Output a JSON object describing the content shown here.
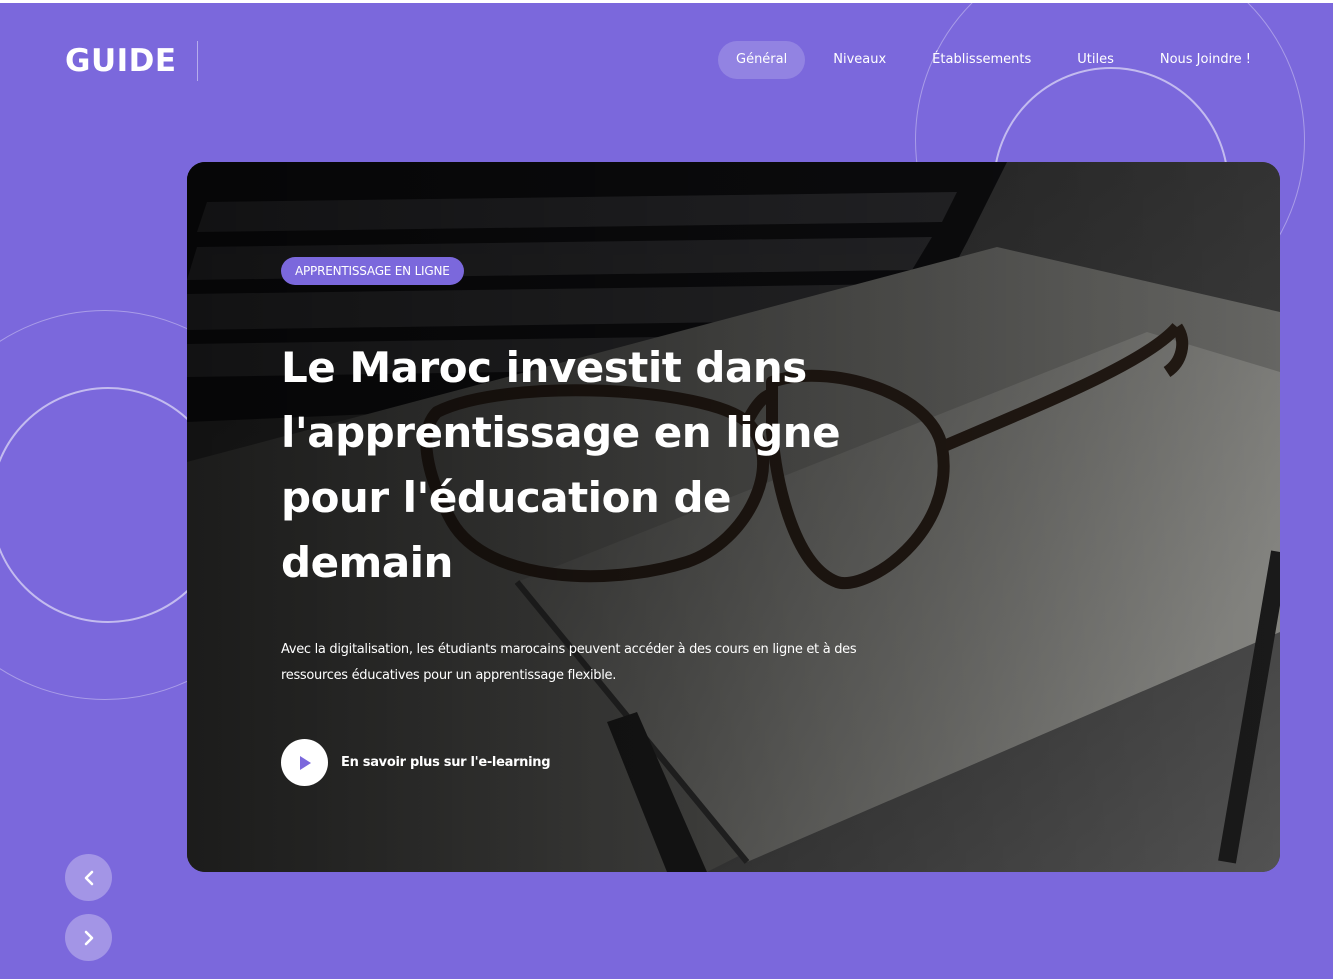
{
  "brand": {
    "logo": "GUIDE",
    "accent_color": "#7b68dc"
  },
  "nav": {
    "items": [
      {
        "label": "Général",
        "active": true
      },
      {
        "label": "Niveaux",
        "active": false
      },
      {
        "label": "Établissements",
        "active": false
      },
      {
        "label": "Utiles",
        "active": false
      },
      {
        "label": "Nous Joindre !",
        "active": false
      }
    ]
  },
  "hero": {
    "badge": "APPRENTISSAGE EN LIGNE",
    "headline": "Le Maroc investit dans l'apprentissage en ligne pour l'éducation de demain",
    "description": "Avec la digitalisation, les étudiants marocains peuvent accéder à des cours en ligne et à des ressources éducatives pour un apprentissage flexible.",
    "cta_label": "En savoir plus sur l'e-learning",
    "cta_icon": "play-icon",
    "image": "laptop-keyboard-eyeglasses-notebook-pen-photo"
  },
  "slider": {
    "prev_icon": "chevron-left-icon",
    "next_icon": "chevron-right-icon"
  }
}
